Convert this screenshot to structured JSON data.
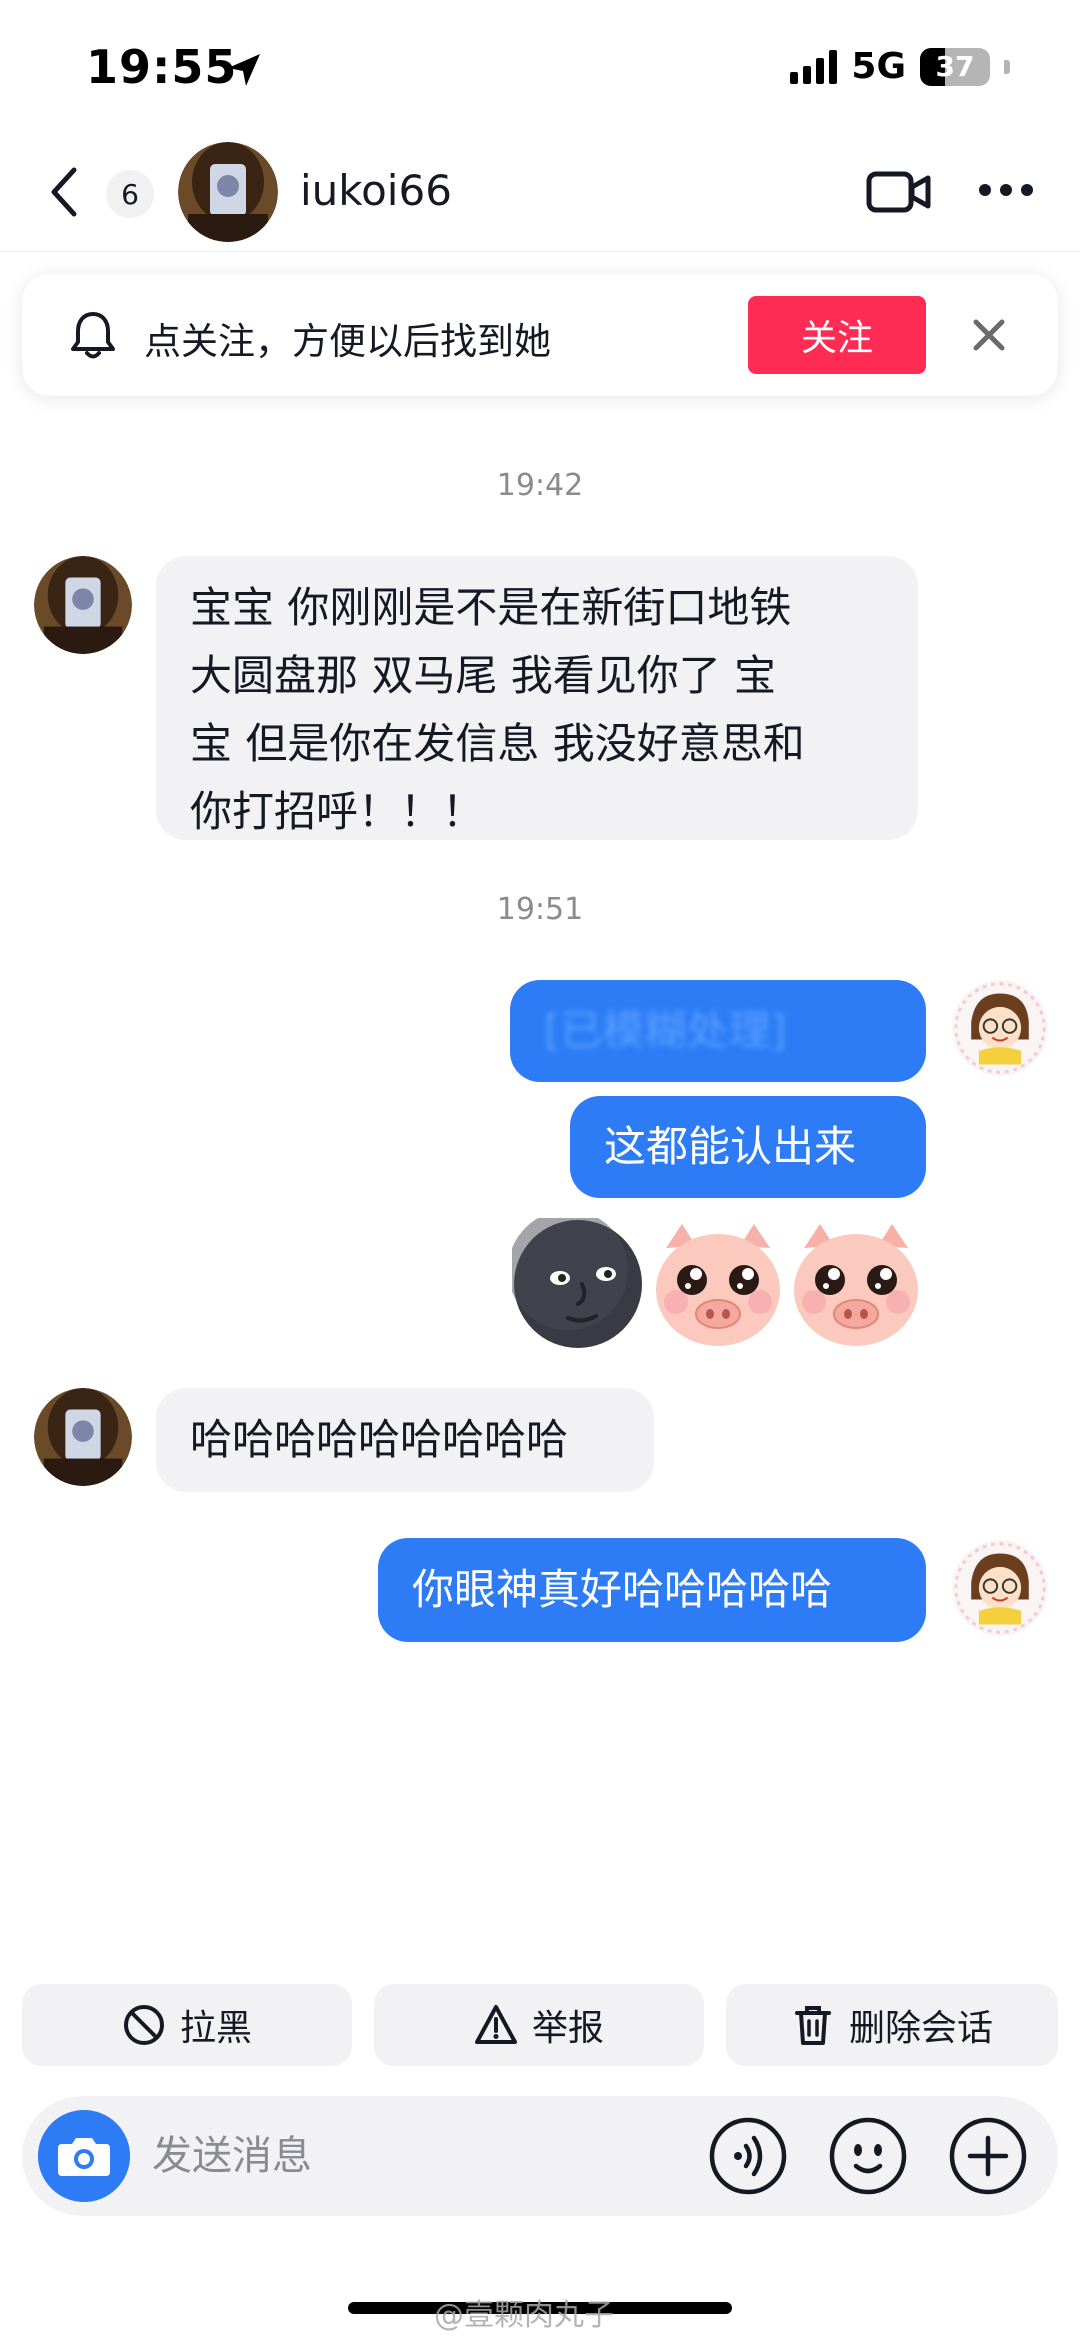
{
  "status_bar": {
    "time": "19:55",
    "network": "5G",
    "battery": "37"
  },
  "header": {
    "unread_count": "6",
    "username": "iukoi66"
  },
  "follow_banner": {
    "text": "点关注，方便以后找到她",
    "button_label": "关注"
  },
  "messages": {
    "ts1": "19:42",
    "msg1": [
      "宝宝 你刚刚是不是在新街口地铁",
      "大圆盘那 双马尾 我看见你了 宝",
      "宝 但是你在发信息 我没好意思和",
      "你打招呼！！！"
    ],
    "ts2": "19:51",
    "msg2_blurred": "[已模糊处理]",
    "msg3": "这都能认出来",
    "stickers": [
      "new-moon-face",
      "pig-face",
      "pig-face"
    ],
    "msg4": "哈哈哈哈哈哈哈哈哈",
    "msg5": "你眼神真好哈哈哈哈哈"
  },
  "actions": {
    "block": "拉黑",
    "report": "举报",
    "delete": "删除会话"
  },
  "composer": {
    "placeholder": "发送消息"
  },
  "watermark": "@壹颗肉丸子",
  "colors": {
    "accent_blue": "#2d7cf6",
    "follow_red": "#fe2c55",
    "bubble_gray": "#f2f2f4"
  }
}
